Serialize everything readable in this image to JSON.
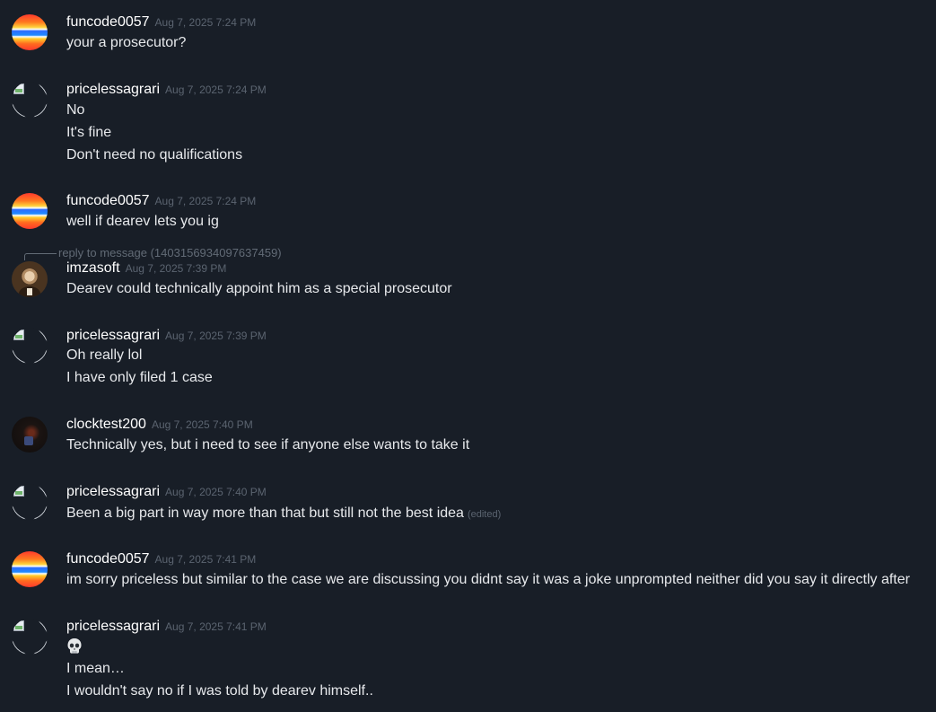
{
  "messages": [
    {
      "user": "funcode0057",
      "time": "Aug 7, 2025 7:24 PM",
      "avatar": "rainbow-striped-avatar",
      "lines": [
        "your a prosecutor?"
      ]
    },
    {
      "user": "pricelessagrari",
      "time": "Aug 7, 2025 7:24 PM",
      "avatar": "broken-image-avatar",
      "lines": [
        "No",
        "It's fine",
        "Don't need no qualifications"
      ]
    },
    {
      "user": "funcode0057",
      "time": "Aug 7, 2025 7:24 PM",
      "avatar": "rainbow-striped-avatar",
      "lines": [
        "well if dearev lets you ig"
      ]
    },
    {
      "reply_to": "reply to message (1403156934097637459)",
      "user": "imzasoft",
      "time": "Aug 7, 2025 7:39 PM",
      "avatar": "portrait-avatar",
      "lines": [
        "Dearev could technically appoint him as a special prosecutor"
      ]
    },
    {
      "user": "pricelessagrari",
      "time": "Aug 7, 2025 7:39 PM",
      "avatar": "broken-image-avatar",
      "lines": [
        "Oh really lol",
        "I have only filed 1 case"
      ]
    },
    {
      "user": "clocktest200",
      "time": "Aug 7, 2025 7:40 PM",
      "avatar": "dark-photo-avatar",
      "lines": [
        "Technically yes, but i need to see if anyone else wants to take it"
      ]
    },
    {
      "user": "pricelessagrari",
      "time": "Aug 7, 2025 7:40 PM",
      "avatar": "broken-image-avatar",
      "lines": [
        "Been a big part in way more than that but still not the best idea"
      ],
      "edited": "(edited)"
    },
    {
      "user": "funcode0057",
      "time": "Aug 7, 2025 7:41 PM",
      "avatar": "rainbow-striped-avatar",
      "lines": [
        "im sorry priceless but similar to the case we are discussing you didnt say it was a joke unprompted neither did you say it directly after"
      ]
    },
    {
      "user": "pricelessagrari",
      "time": "Aug 7, 2025 7:41 PM",
      "avatar": "broken-image-avatar",
      "emoji": "skull-emoji",
      "lines": [
        "I mean…",
        "I wouldn't say no if I was told by dearev himself.."
      ]
    }
  ]
}
